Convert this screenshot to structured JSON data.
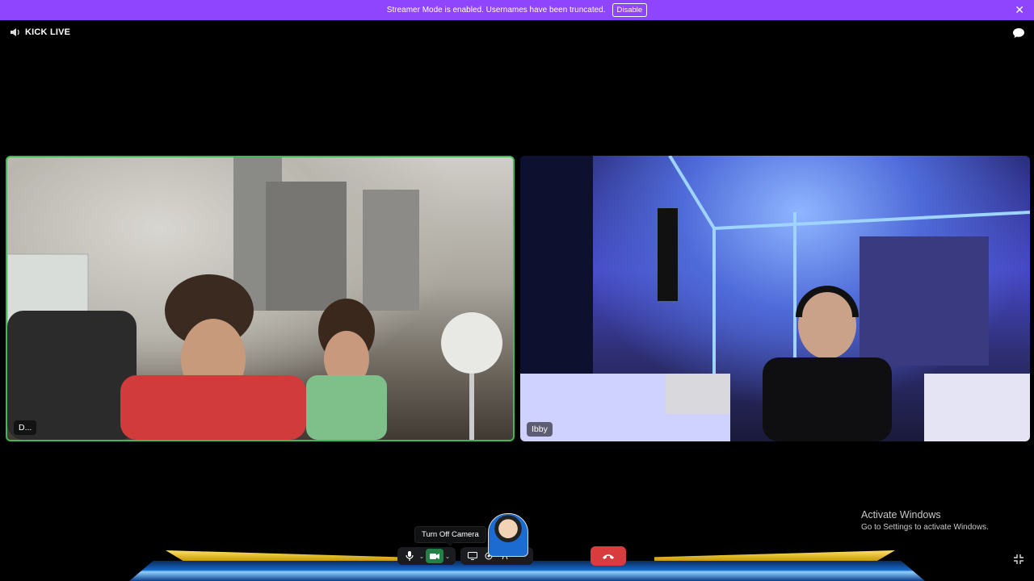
{
  "banner": {
    "message": "Streamer Mode is enabled. Usernames have been truncated.",
    "disable_label": "Disable",
    "close_glyph": "✕"
  },
  "header": {
    "channel_name": "KICK LIVE",
    "speaker_icon": "speaker-icon",
    "chat_icon": "chat-bubble-icon"
  },
  "tiles": [
    {
      "name": "D...",
      "speaking": true,
      "border_color": "#3fb950"
    },
    {
      "name": "Ibby",
      "speaking": false
    }
  ],
  "controls": {
    "tooltip": "Turn Off Camera",
    "mic_icon": "microphone-icon",
    "camera_icon": "camera-icon",
    "screenshare_icon": "screen-share-icon",
    "activity_icon": "activity-icon",
    "soundboard_icon": "soundboard-icon",
    "more_glyph": "···",
    "end_call_icon": "hang-up-icon",
    "end_call_color": "#d83c3e",
    "camera_active_color": "#248046"
  },
  "watermark": {
    "line1": "Activate Windows",
    "line2": "Go to Settings to activate Windows."
  },
  "colors": {
    "banner": "#8f44fd",
    "background": "#000000"
  }
}
